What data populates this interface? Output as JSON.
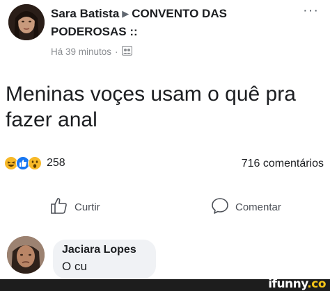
{
  "post": {
    "author": "Sara Batista",
    "group": "CONVENTO DAS",
    "group_line2": "PODEROSAS ::",
    "time": "Há 39 minutos",
    "more_label": "···",
    "text_line1": "Meninas voçes usam  o quê pra",
    "text_line2": "fazer anal",
    "reaction_count": "258",
    "comments_count": "716 comentários",
    "reaction_icons": [
      "haha-reaction-icon",
      "like-reaction-icon",
      "wow-reaction-icon"
    ]
  },
  "actions": {
    "like_label": "Curtir",
    "comment_label": "Comentar"
  },
  "comment": {
    "author": "Jaciara Lopes",
    "text": "O cu"
  },
  "watermark": {
    "brand": "ifunny",
    "suffix": ".co"
  },
  "colors": {
    "text": "#1c1e21",
    "meta": "#8a8d91",
    "like_blue": "#1877f2",
    "reaction_yellow": "#f7b928",
    "bubble": "#f0f2f5",
    "bar": "#1d1d1d",
    "ifunny_yellow": "#f5c518"
  }
}
